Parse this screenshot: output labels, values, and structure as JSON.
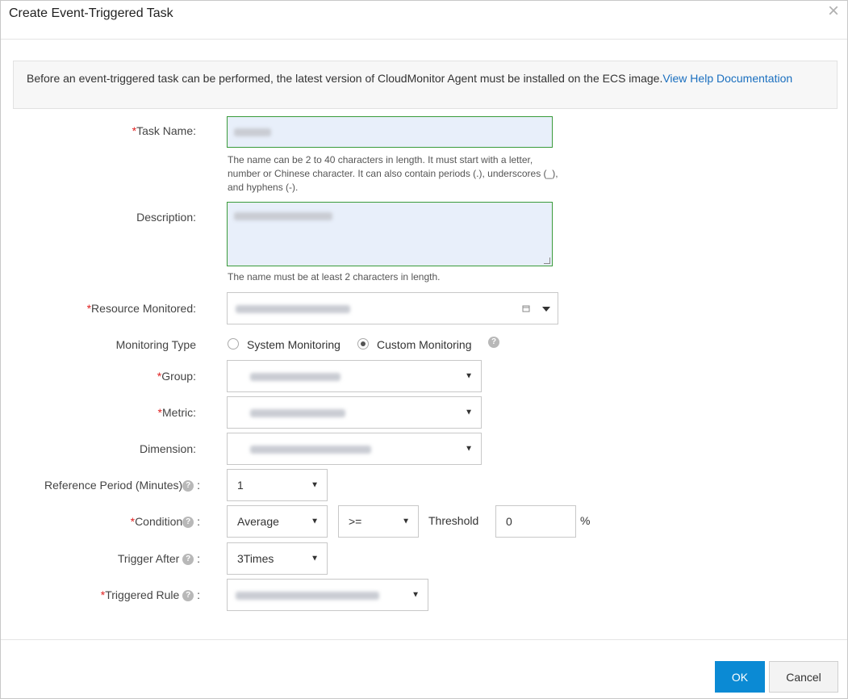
{
  "dialog": {
    "title": "Create Event-Triggered Task",
    "close_glyph": "×"
  },
  "notice": {
    "text": "Before an event-triggered task can be performed, the latest version of CloudMonitor Agent must be installed on the ECS image.",
    "link": "View Help Documentation"
  },
  "form": {
    "required_mark": "*",
    "task_name": {
      "label": "Task Name:",
      "hint": "The name can be 2 to 40 characters in length. It must start with a letter, number or Chinese character. It can also contain periods (.), underscores (_), and hyphens (-)."
    },
    "description": {
      "label": "Description:",
      "hint": "The name must be at least 2 characters in length."
    },
    "resource": {
      "label": "Resource Monitored:"
    },
    "monitoring_type": {
      "label": "Monitoring Type",
      "options": [
        "System Monitoring",
        "Custom Monitoring"
      ],
      "selected": "Custom Monitoring"
    },
    "group": {
      "label": "Group:"
    },
    "metric": {
      "label": "Metric:"
    },
    "dimension": {
      "label": "Dimension:"
    },
    "reference_period": {
      "label": "Reference Period (Minutes)",
      "suffix": ":",
      "value": "1"
    },
    "condition": {
      "label": "Condition",
      "suffix": ":",
      "aggregation": "Average",
      "operator": ">=",
      "threshold_label": "Threshold",
      "threshold_value": "0",
      "unit": "%"
    },
    "trigger_after": {
      "label": "Trigger After",
      "suffix": ":",
      "value": "3Times"
    },
    "triggered_rule": {
      "label": "Triggered Rule",
      "suffix": ":"
    }
  },
  "footer": {
    "ok": "OK",
    "cancel": "Cancel"
  },
  "colors": {
    "primary": "#0b8ad4",
    "link": "#1a6fbf",
    "required": "#e02020",
    "valid_border": "#3a9b3a"
  },
  "icons": {
    "help": "question-circle-icon",
    "close": "close-icon",
    "caret": "caret-down-icon",
    "calendar": "calendar-icon"
  }
}
